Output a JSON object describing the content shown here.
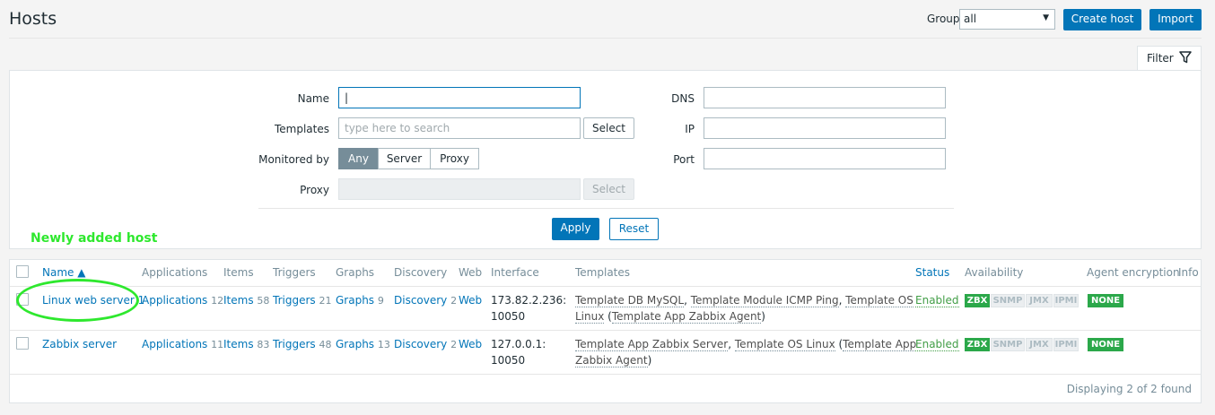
{
  "header": {
    "title": "Hosts",
    "group_label": "Group",
    "group_value": "all",
    "create_host_label": "Create host",
    "import_label": "Import"
  },
  "filter": {
    "tab_label": "Filter",
    "name_label": "Name",
    "name_value": "|",
    "templates_label": "Templates",
    "templates_placeholder": "type here to search",
    "select_label": "Select",
    "monitored_by_label": "Monitored by",
    "monitored_by_options": [
      "Any",
      "Server",
      "Proxy"
    ],
    "monitored_by_selected": "Any",
    "proxy_label": "Proxy",
    "proxy_select_label": "Select",
    "dns_label": "DNS",
    "ip_label": "IP",
    "port_label": "Port",
    "apply_label": "Apply",
    "reset_label": "Reset"
  },
  "annotation": {
    "text": "Newly added host",
    "color": "#2ee82e"
  },
  "table": {
    "columns": [
      "Name ▲",
      "Applications",
      "Items",
      "Triggers",
      "Graphs",
      "Discovery",
      "Web",
      "Interface",
      "Templates",
      "Status",
      "Availability",
      "Agent encryption",
      "Info"
    ],
    "rows": [
      {
        "name": "Linux web server 1",
        "applications": "Applications",
        "applications_count": "12",
        "items": "Items",
        "items_count": "58",
        "triggers": "Triggers",
        "triggers_count": "21",
        "graphs": "Graphs",
        "graphs_count": "9",
        "discovery": "Discovery",
        "discovery_count": "2",
        "web": "Web",
        "interface_line1": "173.82.2.236:",
        "interface_line2": "10050",
        "tmpl_1": "Template DB MySQL",
        "sep_1": ", ",
        "tmpl_2": "Template Module ICMP Ping",
        "sep_2": ", ",
        "tmpl_3a": "Template OS",
        "tmpl_3b": "Linux",
        "paren_open": " (",
        "tmpl_4": "Template App Zabbix Agent",
        "paren_close": ")",
        "status": "Enabled",
        "availability": [
          "ZBX",
          "SNMP",
          "JMX",
          "IPMI"
        ],
        "encryption": "NONE"
      },
      {
        "name": "Zabbix server",
        "applications": "Applications",
        "applications_count": "11",
        "items": "Items",
        "items_count": "83",
        "triggers": "Triggers",
        "triggers_count": "48",
        "graphs": "Graphs",
        "graphs_count": "13",
        "discovery": "Discovery",
        "discovery_count": "2",
        "web": "Web",
        "interface_line1": "127.0.0.1:",
        "interface_line2": "10050",
        "tmpl_1": "Template App Zabbix Server",
        "sep_1": ", ",
        "tmpl_2": "Template OS Linux",
        "paren_open": " (",
        "tmpl_3a": "Template App",
        "tmpl_3b": "Zabbix Agent",
        "paren_close": ")",
        "status": "Enabled",
        "availability": [
          "ZBX",
          "SNMP",
          "JMX",
          "IPMI"
        ],
        "encryption": "NONE"
      }
    ],
    "footer": "Displaying 2 of 2 found"
  }
}
